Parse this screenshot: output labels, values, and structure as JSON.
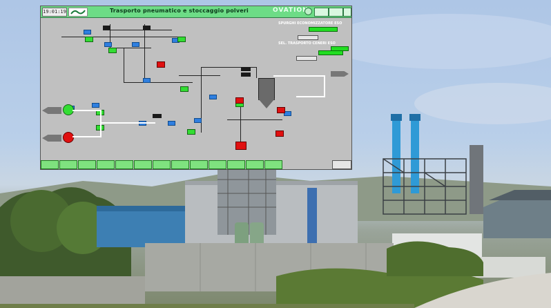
{
  "header": {
    "clock": "19:01:19",
    "area_line1": "",
    "area_line2": "",
    "title": "Trasporto pneumatico e stoccaggio polveri",
    "brand": "OVATION",
    "buttons": [
      "",
      "",
      ""
    ]
  },
  "right_panel": {
    "section1_title": "SPURGHI ECONOMIZZATORE ESO",
    "section2_title": "SEL. TRASPORTO CENERI ESO",
    "status_labels": [
      "",
      ""
    ],
    "buttons": [
      "",
      ""
    ]
  },
  "footer": {
    "buttons": [
      "",
      "",
      "",
      "",
      "",
      "",
      "",
      "",
      "",
      "",
      "",
      "",
      ""
    ],
    "right_box": ""
  },
  "colors": {
    "header_green": "#6ddc86",
    "panel_gray": "#c0c0c0",
    "running_green": "#33dd33",
    "alarm_red": "#e01010",
    "valve_blue": "#2f7fe0",
    "footer_green": "#7fe27f"
  },
  "icons": {
    "brand": "ovation-logo-icon",
    "logo": "company-logo-icon",
    "silo": "silo-icon",
    "truck": "truck-icon",
    "pump": "blower-icon",
    "valve": "valve-icon"
  }
}
